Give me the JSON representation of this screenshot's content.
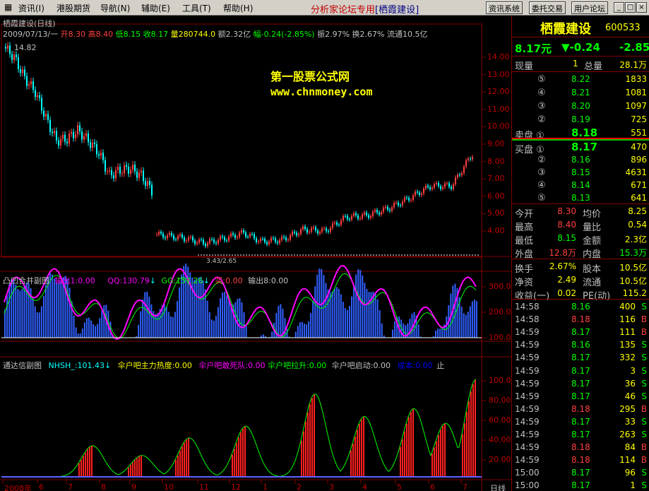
{
  "menu": {
    "items": [
      "资讯(I)",
      "港股期货",
      "导航(N)",
      "辅助(E)",
      "工具(T)",
      "帮助(H)"
    ],
    "headline_prefix": "分析家论坛专用",
    "headline_stock": "[栖霞建设]",
    "buttons": [
      "资讯系统",
      "委托交易",
      "用户论坛"
    ],
    "win_buttons": [
      "_",
      "□",
      "×"
    ]
  },
  "chart_header": {
    "title": "栖霞建设(日线)",
    "date": "2009/07/13/一",
    "open": "开8.30",
    "high": "高8.40",
    "low": "低8.15",
    "close": "收8.17",
    "volume": "量280744.0",
    "amount": "额2.32亿",
    "change": "幅-0.24(-2.85%)",
    "amplitude": "振2.97%",
    "turnover": "换2.67%",
    "float": "流通10.5亿"
  },
  "watermark": {
    "line1": "第一股票公式网",
    "line2": "www.chnmoney.com"
  },
  "price_labels": {
    "high": "14.82",
    "low": "3.43",
    "low_value": "2.65"
  },
  "sub1": {
    "name": "凸凹合并副图",
    "out1": "输出1:0.00",
    "qq": "QQ:130.79",
    "gg": "GG:157.26",
    "buy": "买:0.00",
    "out8": "输出8:0.00"
  },
  "sub2": {
    "name": "通达信副图",
    "nhsh": "NHSH_:101.43",
    "heat": "伞户吧主力热度:0.00",
    "dare": "伞户吧敢死队:0.00",
    "pull": "伞户吧拉升:0.00",
    "start": "伞户吧启动:0.00",
    "cost": "成本:0.00",
    "stop": "止"
  },
  "axis": {
    "main_ticks": [
      "14.00",
      "13.00",
      "12.00",
      "11.00",
      "10.00",
      "9.00",
      "8.00",
      "7.00",
      "6.00",
      "5.00",
      "4.00"
    ],
    "sub1_ticks": [
      "300.0",
      "200.0",
      "100.0"
    ],
    "sub2_ticks": [
      "100.0",
      "80.00",
      "60.00",
      "40.00",
      "20.00"
    ],
    "x_labels": [
      "2008年",
      "6",
      "7",
      "8",
      "9",
      "10",
      "11",
      "12",
      "1",
      "2",
      "3",
      "4",
      "5",
      "6",
      "7"
    ],
    "period": "日线"
  },
  "quote": {
    "name": "栖霞建设",
    "code": "600533",
    "price": "8.17元",
    "change": "▼-0.24",
    "pct": "-2.85",
    "now_vol_label": "现量",
    "now_vol": "1",
    "total_label": "总量",
    "total": "28.1万",
    "sells": [
      {
        "lvl": "⑤",
        "price": "8.22",
        "vol": "1833"
      },
      {
        "lvl": "④",
        "price": "8.21",
        "vol": "1081"
      },
      {
        "lvl": "③",
        "price": "8.20",
        "vol": "1097"
      },
      {
        "lvl": "②",
        "price": "8.19",
        "vol": "725"
      },
      {
        "lvl": "卖盘 ①",
        "price": "8.18",
        "vol": "551"
      }
    ],
    "buys": [
      {
        "lvl": "买盘 ①",
        "price": "8.17",
        "vol": "470"
      },
      {
        "lvl": "②",
        "price": "8.16",
        "vol": "896"
      },
      {
        "lvl": "③",
        "price": "8.15",
        "vol": "4631"
      },
      {
        "lvl": "④",
        "price": "8.14",
        "vol": "671"
      },
      {
        "lvl": "⑤",
        "price": "8.13",
        "vol": "641"
      }
    ],
    "stats": [
      {
        "l1": "今开",
        "v1": "8.30",
        "l2": "均价",
        "v2": "8.25"
      },
      {
        "l1": "最高",
        "v1": "8.40",
        "l2": "量比",
        "v2": "0.54"
      },
      {
        "l1": "最低",
        "v1": "8.15",
        "l2": "金额",
        "v2": "2.3亿"
      },
      {
        "l1": "外盘",
        "v1": "12.8万",
        "l2": "内盘",
        "v2": "15.3万"
      }
    ],
    "stats2": [
      {
        "l1": "换手",
        "v1": "2.67%",
        "l2": "股本",
        "v2": "10.5亿"
      },
      {
        "l1": "净资",
        "v1": "2.49",
        "l2": "流通",
        "v2": "10.5亿"
      },
      {
        "l1": "收益(一)",
        "v1": "0.02",
        "l2": "PE(动)",
        "v2": "115.2"
      }
    ],
    "ticks": [
      {
        "t": "14:58",
        "p": "8.16",
        "v": "400",
        "s": "S"
      },
      {
        "t": "14:58",
        "p": "8.18",
        "v": "116",
        "s": "B"
      },
      {
        "t": "14:59",
        "p": "8.17",
        "v": "111",
        "s": "B"
      },
      {
        "t": "14:59",
        "p": "8.16",
        "v": "135",
        "s": "S"
      },
      {
        "t": "14:59",
        "p": "8.17",
        "v": "332",
        "s": "S"
      },
      {
        "t": "14:59",
        "p": "8.17",
        "v": "3",
        "s": "S"
      },
      {
        "t": "14:59",
        "p": "8.17",
        "v": "36",
        "s": "S"
      },
      {
        "t": "14:59",
        "p": "8.17",
        "v": "46",
        "s": "S"
      },
      {
        "t": "14:59",
        "p": "8.18",
        "v": "295",
        "s": "B"
      },
      {
        "t": "14:59",
        "p": "8.17",
        "v": "33",
        "s": "S"
      },
      {
        "t": "14:59",
        "p": "8.17",
        "v": "263",
        "s": "S"
      },
      {
        "t": "14:59",
        "p": "8.18",
        "v": "84",
        "s": "B"
      },
      {
        "t": "14:59",
        "p": "8.18",
        "v": "114",
        "s": "B"
      },
      {
        "t": "15:00",
        "p": "8.17",
        "v": "96",
        "s": "S"
      },
      {
        "t": "15:00",
        "p": "8.17",
        "v": "1",
        "s": "S"
      }
    ]
  }
}
